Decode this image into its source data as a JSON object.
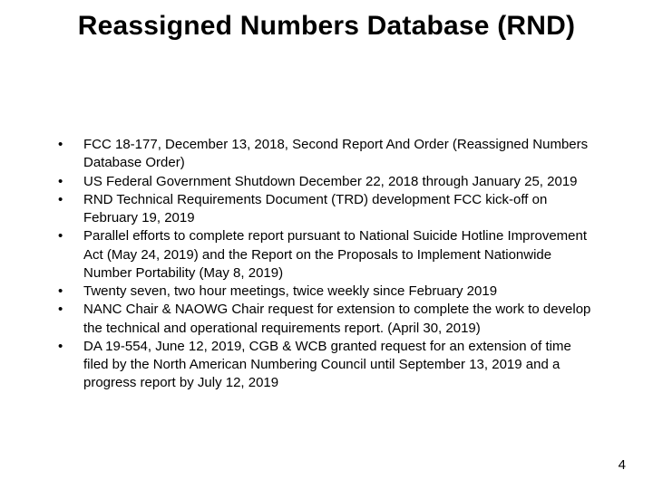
{
  "title": "Reassigned Numbers Database (RND)",
  "bullets": [
    "FCC 18-177, December 13, 2018, Second Report And Order (Reassigned Numbers Database Order)",
    "US Federal Government Shutdown December 22, 2018 through January 25, 2019",
    "RND Technical Requirements Document (TRD) development FCC kick-off on February 19, 2019",
    "Parallel efforts to complete report pursuant to National Suicide Hotline Improvement Act (May 24, 2019) and the Report on the Proposals to Implement Nationwide Number Portability (May 8, 2019)",
    "Twenty seven, two hour meetings, twice weekly since February 2019",
    "NANC Chair & NAOWG Chair request for extension to complete the work to develop the technical and operational requirements report. (April 30, 2019)",
    "DA 19-554, June 12, 2019, CGB & WCB granted request for an extension of time filed by the North American Numbering Council until September 13, 2019 and a progress report by July 12, 2019"
  ],
  "page_number": "4"
}
